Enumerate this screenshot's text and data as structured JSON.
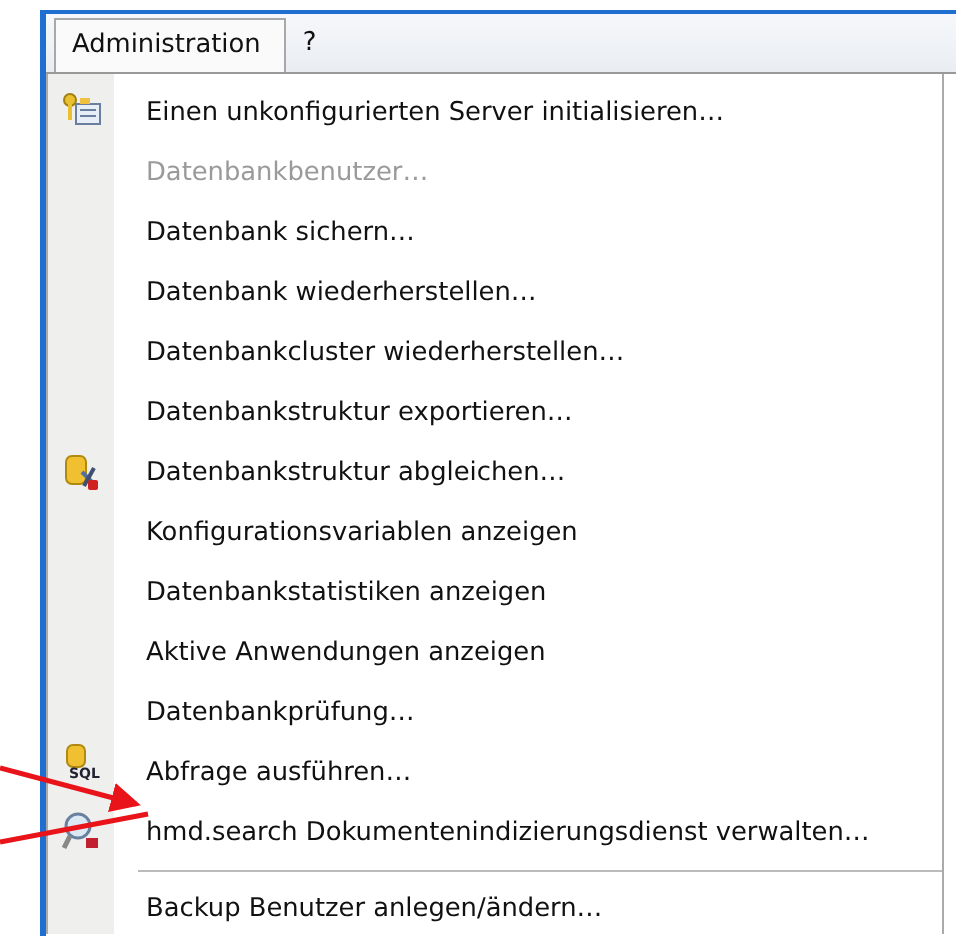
{
  "menu_bar": [
    {
      "label": "Administration",
      "selected": true
    },
    {
      "label": "?",
      "selected": false
    }
  ],
  "menu": {
    "items": [
      {
        "kind": "item",
        "label": "Einen unkonfigurierten Server initialisieren…",
        "disabled": false
      },
      {
        "kind": "item",
        "label": "Datenbankbenutzer…",
        "disabled": true
      },
      {
        "kind": "item",
        "label": "Datenbank sichern…",
        "disabled": false
      },
      {
        "kind": "item",
        "label": "Datenbank wiederherstellen…",
        "disabled": false
      },
      {
        "kind": "item",
        "label": "Datenbankcluster wiederherstellen…",
        "disabled": false
      },
      {
        "kind": "item",
        "label": "Datenbankstruktur exportieren…",
        "disabled": false
      },
      {
        "kind": "item",
        "label": "Datenbankstruktur abgleichen…",
        "disabled": false
      },
      {
        "kind": "item",
        "label": "Konfigurationsvariablen anzeigen",
        "disabled": false
      },
      {
        "kind": "item",
        "label": "Datenbankstatistiken anzeigen",
        "disabled": false
      },
      {
        "kind": "item",
        "label": "Aktive Anwendungen anzeigen",
        "disabled": false
      },
      {
        "kind": "item",
        "label": "Datenbankprüfung…",
        "disabled": false
      },
      {
        "kind": "item",
        "label": "Abfrage ausführen…",
        "disabled": false,
        "icon_label": "SQL"
      },
      {
        "kind": "item",
        "label": "hmd.search Dokumentenindizierungsdienst verwalten…",
        "disabled": false
      },
      {
        "kind": "separator"
      },
      {
        "kind": "item",
        "label": "Backup Benutzer anlegen/ändern…",
        "disabled": false
      }
    ]
  }
}
